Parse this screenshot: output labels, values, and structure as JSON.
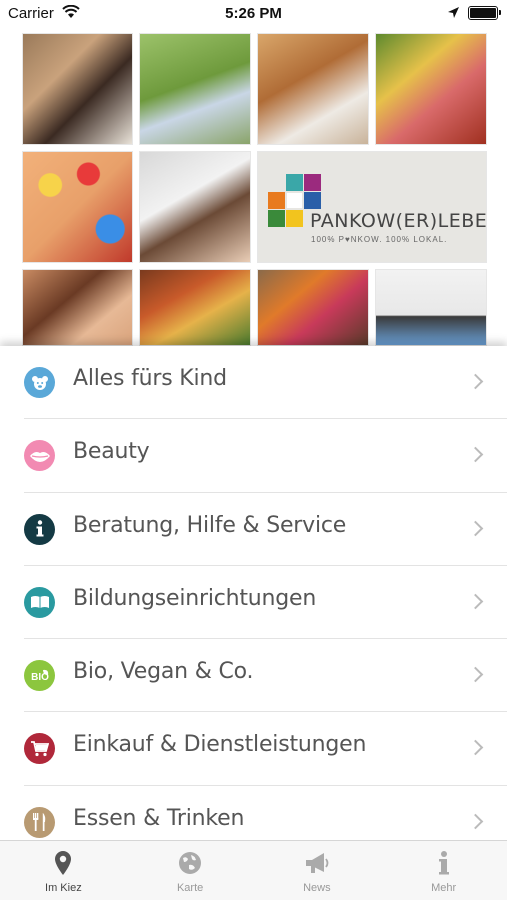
{
  "status_bar": {
    "carrier": "Carrier",
    "time": "5:26 PM"
  },
  "banner": {
    "logo_text": "PANKOW(ER)LEBEN",
    "logo_tagline": "100% P♥NKOW. 100% LOKAL."
  },
  "categories": [
    {
      "label": "Alles fürs Kind",
      "icon": "bear-icon",
      "color": "#5aa8d8"
    },
    {
      "label": "Beauty",
      "icon": "lips-icon",
      "color": "#f28ab2"
    },
    {
      "label": "Beratung, Hilfe & Service",
      "icon": "info-icon",
      "color": "#143a44"
    },
    {
      "label": "Bildungseinrichtungen",
      "icon": "book-icon",
      "color": "#2a9aa0"
    },
    {
      "label": "Bio, Vegan & Co.",
      "icon": "bio-icon",
      "color": "#8cc63e"
    },
    {
      "label": "Einkauf & Dienstleistungen",
      "icon": "cart-icon",
      "color": "#b0283a"
    },
    {
      "label": "Essen & Trinken",
      "icon": "cutlery-icon",
      "color": "#b89a72"
    }
  ],
  "tabs": [
    {
      "label": "Im Kiez",
      "icon": "location-pin-icon",
      "active": true
    },
    {
      "label": "Karte",
      "icon": "globe-icon",
      "active": false
    },
    {
      "label": "News",
      "icon": "megaphone-icon",
      "active": false
    },
    {
      "label": "Mehr",
      "icon": "info-icon",
      "active": false
    }
  ],
  "colors": {
    "tab_active": "#444444",
    "tab_inactive": "#999999"
  }
}
